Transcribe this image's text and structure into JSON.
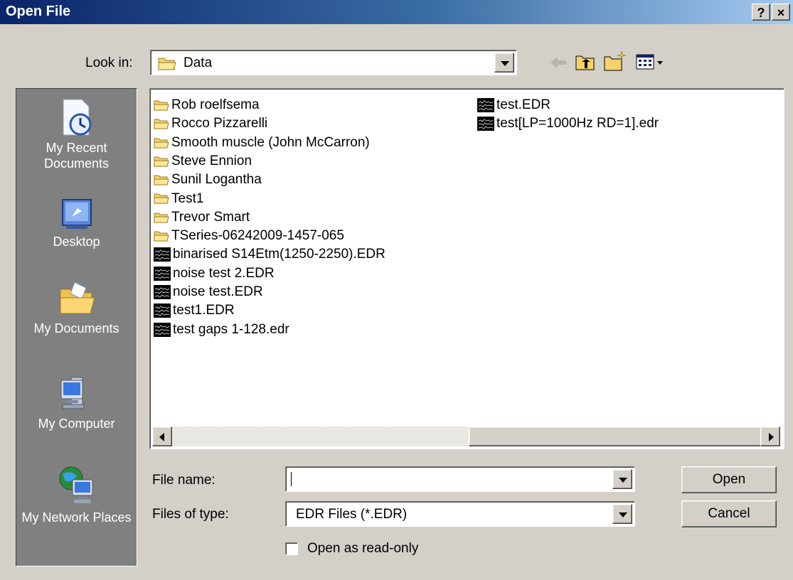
{
  "window": {
    "title": "Open File",
    "help_label": "?",
    "close_label": "×"
  },
  "toolbar": {
    "look_in_label": "Look in:",
    "look_in_value": "Data",
    "back_icon": "back-arrow-icon",
    "up_icon": "up-folder-icon",
    "new_folder_icon": "new-folder-icon",
    "views_icon": "views-menu-icon"
  },
  "places": [
    {
      "label": "My Recent Documents",
      "icon": "recent-documents-icon"
    },
    {
      "label": "Desktop",
      "icon": "desktop-icon"
    },
    {
      "label": "My Documents",
      "icon": "my-documents-icon"
    },
    {
      "label": "My Computer",
      "icon": "my-computer-icon"
    },
    {
      "label": "My Network Places",
      "icon": "network-places-icon"
    }
  ],
  "files": {
    "column1": [
      {
        "name": "Rob roelfsema",
        "type": "folder"
      },
      {
        "name": "Rocco Pizzarelli",
        "type": "folder"
      },
      {
        "name": "Smooth muscle (John McCarron)",
        "type": "folder"
      },
      {
        "name": "Steve Ennion",
        "type": "folder"
      },
      {
        "name": "Sunil Logantha",
        "type": "folder"
      },
      {
        "name": "Test1",
        "type": "folder"
      },
      {
        "name": "Trevor Smart",
        "type": "folder"
      },
      {
        "name": "TSeries-06242009-1457-065",
        "type": "folder"
      },
      {
        "name": "binarised S14Etm(1250-2250).EDR",
        "type": "edr"
      },
      {
        "name": "noise test 2.EDR",
        "type": "edr"
      },
      {
        "name": "noise test.EDR",
        "type": "edr"
      },
      {
        "name": "test1.EDR",
        "type": "edr"
      },
      {
        "name": "test gaps 1-128.edr",
        "type": "edr"
      }
    ],
    "column2": [
      {
        "name": "test.EDR",
        "type": "edr"
      },
      {
        "name": "test[LP=1000Hz RD=1].edr",
        "type": "edr"
      }
    ]
  },
  "form": {
    "file_name_label": "File name:",
    "file_name_value": "",
    "files_of_type_label": "Files of type:",
    "files_of_type_value": "EDR Files (*.EDR)",
    "read_only_label": "Open as read-only",
    "read_only_checked": false,
    "open_label": "Open",
    "cancel_label": "Cancel"
  },
  "colors": {
    "title_start": "#0a246a",
    "title_end": "#a6caf0",
    "face": "#d4d0c8",
    "places_bg": "#808080"
  }
}
